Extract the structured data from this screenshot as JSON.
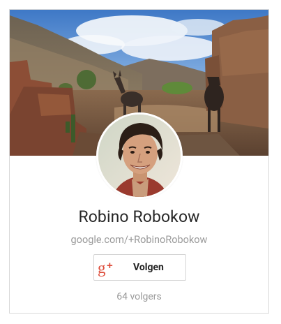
{
  "profile": {
    "name": "Robino Robokow",
    "url": "google.com/+RobinoRobokow",
    "follow_label": "Volgen",
    "followers": "64 volgers",
    "follow_icon": "google-plus-icon"
  },
  "colors": {
    "brand_red": "#dd4b39",
    "name_text": "#262626",
    "secondary_text": "#9a9a9a",
    "border": "#d9d9d9"
  }
}
